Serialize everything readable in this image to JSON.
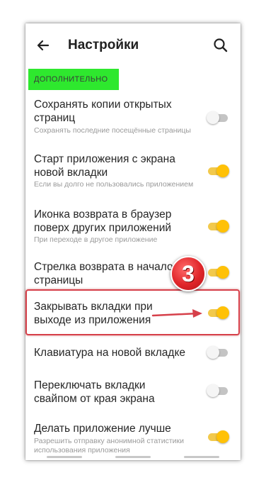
{
  "header": {
    "title": "Настройки",
    "back_icon": "arrow-left-icon",
    "search_icon": "search-icon"
  },
  "section": {
    "label": "ДОПОЛНИТЕЛЬНО",
    "highlight_color": "#2ee82e"
  },
  "settings": [
    {
      "title": "Сохранять копии открытых страниц",
      "subtitle": "Сохранять последние посещённые страницы",
      "enabled": false
    },
    {
      "title": "Старт приложения с экрана новой вкладки",
      "subtitle": "Если вы долго не пользовались приложением",
      "enabled": true
    },
    {
      "title": "Иконка возврата в браузер поверх других приложений",
      "subtitle": "При переходе в другое приложение",
      "enabled": true
    },
    {
      "title": "Стрелка возврата в начало страницы",
      "subtitle": "",
      "enabled": true
    },
    {
      "title": "Закрывать вкладки при выходе из приложения",
      "subtitle": "",
      "enabled": true
    },
    {
      "title": "Клавиатура на новой вкладке",
      "subtitle": "",
      "enabled": false
    },
    {
      "title": "Переключать вкладки свайпом от края экрана",
      "subtitle": "",
      "enabled": false
    },
    {
      "title": "Делать приложение лучше",
      "subtitle": "Разрешить отправку анонимной статистики использования приложения",
      "enabled": true
    }
  ],
  "annotation": {
    "step_number": "3",
    "badge_color": "#e0262a",
    "box_color": "#d6404a"
  },
  "colors": {
    "toggle_on": "#ffc107",
    "toggle_off": "#c4c4c4"
  }
}
